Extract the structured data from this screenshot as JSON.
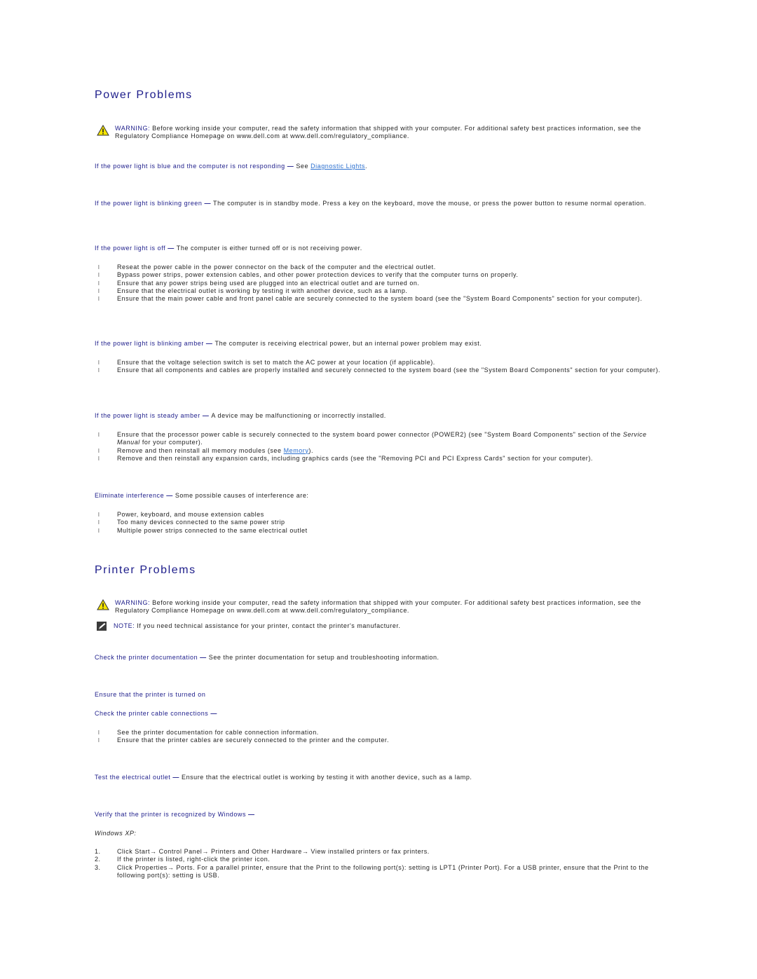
{
  "power": {
    "title": "Power Problems",
    "warning": {
      "label": "WARNING:",
      "text": " Before working inside your computer, read the safety information that shipped with your computer. For additional safety best practices information, see the Regulatory Compliance Homepage on www.dell.com at www.dell.com/regulatory_compliance."
    },
    "blue": {
      "lead": "If the power light is blue and the computer is not responding",
      "dash": " — ",
      "pre": "See ",
      "link": "Diagnostic Lights",
      "post": "."
    },
    "green": {
      "lead": "If the power light is blinking green",
      "dash": " — ",
      "text": "The computer is in standby mode. Press a key on the keyboard, move the mouse, or press the power button to resume normal operation."
    },
    "off": {
      "lead": "If the power light is off",
      "dash": " — ",
      "text": "The computer is either turned off or is not receiving power.",
      "items": [
        "Reseat the power cable in the power connector on the back of the computer and the electrical outlet.",
        "Bypass power strips, power extension cables, and other power protection devices to verify that the computer turns on properly.",
        "Ensure that any power strips being used are plugged into an electrical outlet and are turned on.",
        "Ensure that the electrical outlet is working by testing it with another device, such as a lamp.",
        "Ensure that the main power cable and front panel cable are securely connected to the system board (see the \"System Board Components\" section for your computer)."
      ]
    },
    "blinking_amber": {
      "lead": "If the power light is blinking amber",
      "dash": " — ",
      "text": "The computer is receiving electrical power, but an internal power problem may exist.",
      "items": [
        "Ensure that the voltage selection switch is set to match the AC power at your location (if applicable).",
        "Ensure that all components and cables are properly installed and securely connected to the system board (see the \"System Board Components\" section for your computer)."
      ]
    },
    "steady_amber": {
      "lead": "If the power light is steady amber",
      "dash": " — ",
      "text": "A device may be malfunctioning or incorrectly installed.",
      "item1_pre": "Ensure that the processor power cable is securely connected to the system board power connector (POWER2) (see \"System Board Components\" section of the ",
      "item1_italic": "Service Manual",
      "item1_post": " for your computer).",
      "item2_pre": "Remove and then reinstall all memory modules (see ",
      "item2_link": "Memory",
      "item2_post": ").",
      "item3": "Remove and then reinstall any expansion cards, including graphics cards (see the \"Removing PCI and PCI Express Cards\" section for your computer)."
    },
    "interference": {
      "lead": "Eliminate interference",
      "dash": " — ",
      "text": "Some possible causes of interference are:",
      "items": [
        "Power, keyboard, and mouse extension cables",
        "Too many devices connected to the same power strip",
        "Multiple power strips connected to the same electrical outlet"
      ]
    }
  },
  "printer": {
    "title": "Printer Problems",
    "warning": {
      "label": "WARNING:",
      "text": " Before working inside your computer, read the safety information that shipped with your computer. For additional safety best practices information, see the Regulatory Compliance Homepage on www.dell.com at www.dell.com/regulatory_compliance."
    },
    "note": {
      "label": "NOTE:",
      "text": " If you need technical assistance for your printer, contact the printer's manufacturer."
    },
    "documentation": {
      "lead": "Check the printer documentation",
      "dash": " — ",
      "text": "See the printer documentation for setup and troubleshooting information."
    },
    "turned_on": {
      "lead": "Ensure that the printer is turned on"
    },
    "cable": {
      "lead": "Check the printer cable connections",
      "dash": " —",
      "items": [
        "See the printer documentation for cable connection information.",
        "Ensure that the printer cables are securely connected to the printer and the computer."
      ]
    },
    "outlet": {
      "lead": "Test the electrical outlet",
      "dash": " — ",
      "text": "Ensure that the electrical outlet is working by testing it with another device, such as a lamp."
    },
    "windows": {
      "lead": "Verify that the printer is recognized by Windows",
      "dash": " —",
      "os_label": "Windows XP:",
      "steps": [
        {
          "num": "1.",
          "text": "Click Start→ Control Panel→ Printers and Other Hardware→ View installed printers or fax printers."
        },
        {
          "num": "2.",
          "text": "If the printer is listed, right-click the printer icon."
        },
        {
          "num": "3.",
          "text": "Click Properties→ Ports. For a parallel printer, ensure that the Print to the following port(s): setting is LPT1 (Printer Port). For a USB printer, ensure that the Print to the following port(s): setting is USB."
        }
      ]
    }
  },
  "bullet_glyph": "l"
}
